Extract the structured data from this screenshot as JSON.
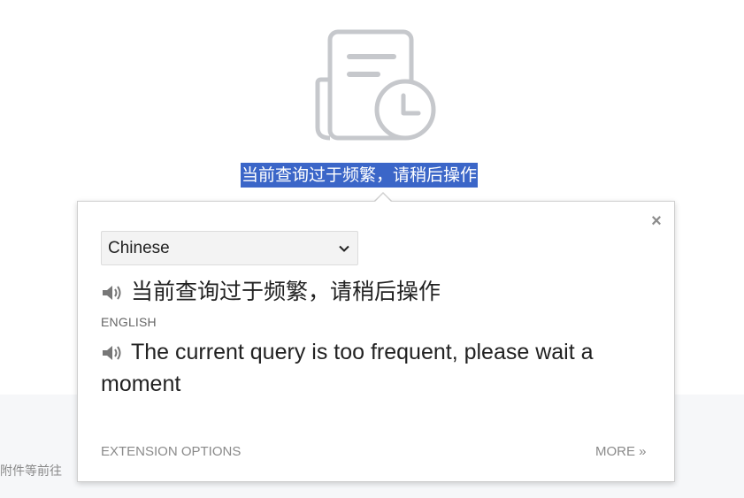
{
  "page": {
    "empty_state_message": "当前查询过于频繁，请稍后操作",
    "footer_fragment": "附件等前往"
  },
  "popup": {
    "close_label": "×",
    "source_language": "Chinese",
    "source_text": "当前查询过于频繁，请稍后操作",
    "target_language_label": "ENGLISH",
    "translated_text": "The current query is too frequent, please wait a moment",
    "options_link": "EXTENSION OPTIONS",
    "more_link": "MORE »"
  },
  "icons": {
    "document": "document-clock-icon",
    "speaker": "speaker-icon",
    "chevron": "chevron-down-icon"
  },
  "colors": {
    "selection": "#3b66c8",
    "icon_gray": "#c6c8cc",
    "muted_text": "#8a8a8a"
  }
}
